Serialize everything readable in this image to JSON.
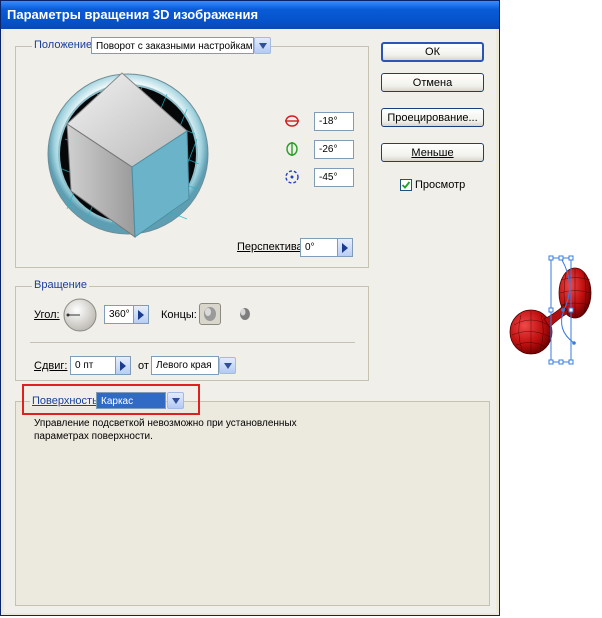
{
  "window": {
    "title": "Параметры вращения 3D изображения"
  },
  "position": {
    "label": "Положение:",
    "preset": "Поворот с заказными настройками",
    "x_angle": "-18°",
    "y_angle": "-26°",
    "z_angle": "-45°",
    "perspective_label": "Перспектива:",
    "perspective_value": "0°"
  },
  "buttons": {
    "ok": "ОК",
    "cancel": "Отмена",
    "map_art": "Проецирование...",
    "fewer_options": "Меньше",
    "preview": "Просмотр"
  },
  "preview_checked": true,
  "revolve": {
    "title": "Вращение",
    "angle_label": "Угол:",
    "angle_value": "360°",
    "cap_label": "Концы:",
    "offset_label": "Сдвиг:",
    "offset_value": "0 пт",
    "from_label": "от",
    "from_value": "Левого края"
  },
  "surface": {
    "label": "Поверхность:",
    "value": "Каркас",
    "message": "Управление подсветкой невозможно при установленных параметрах поверхности."
  },
  "colors": {
    "title_bar": "#0A5BD7",
    "highlight_box": "#E02020",
    "cube_face": "#6AB3C8",
    "object_red": "#D01818",
    "selection_blue": "#3A7BE0"
  }
}
